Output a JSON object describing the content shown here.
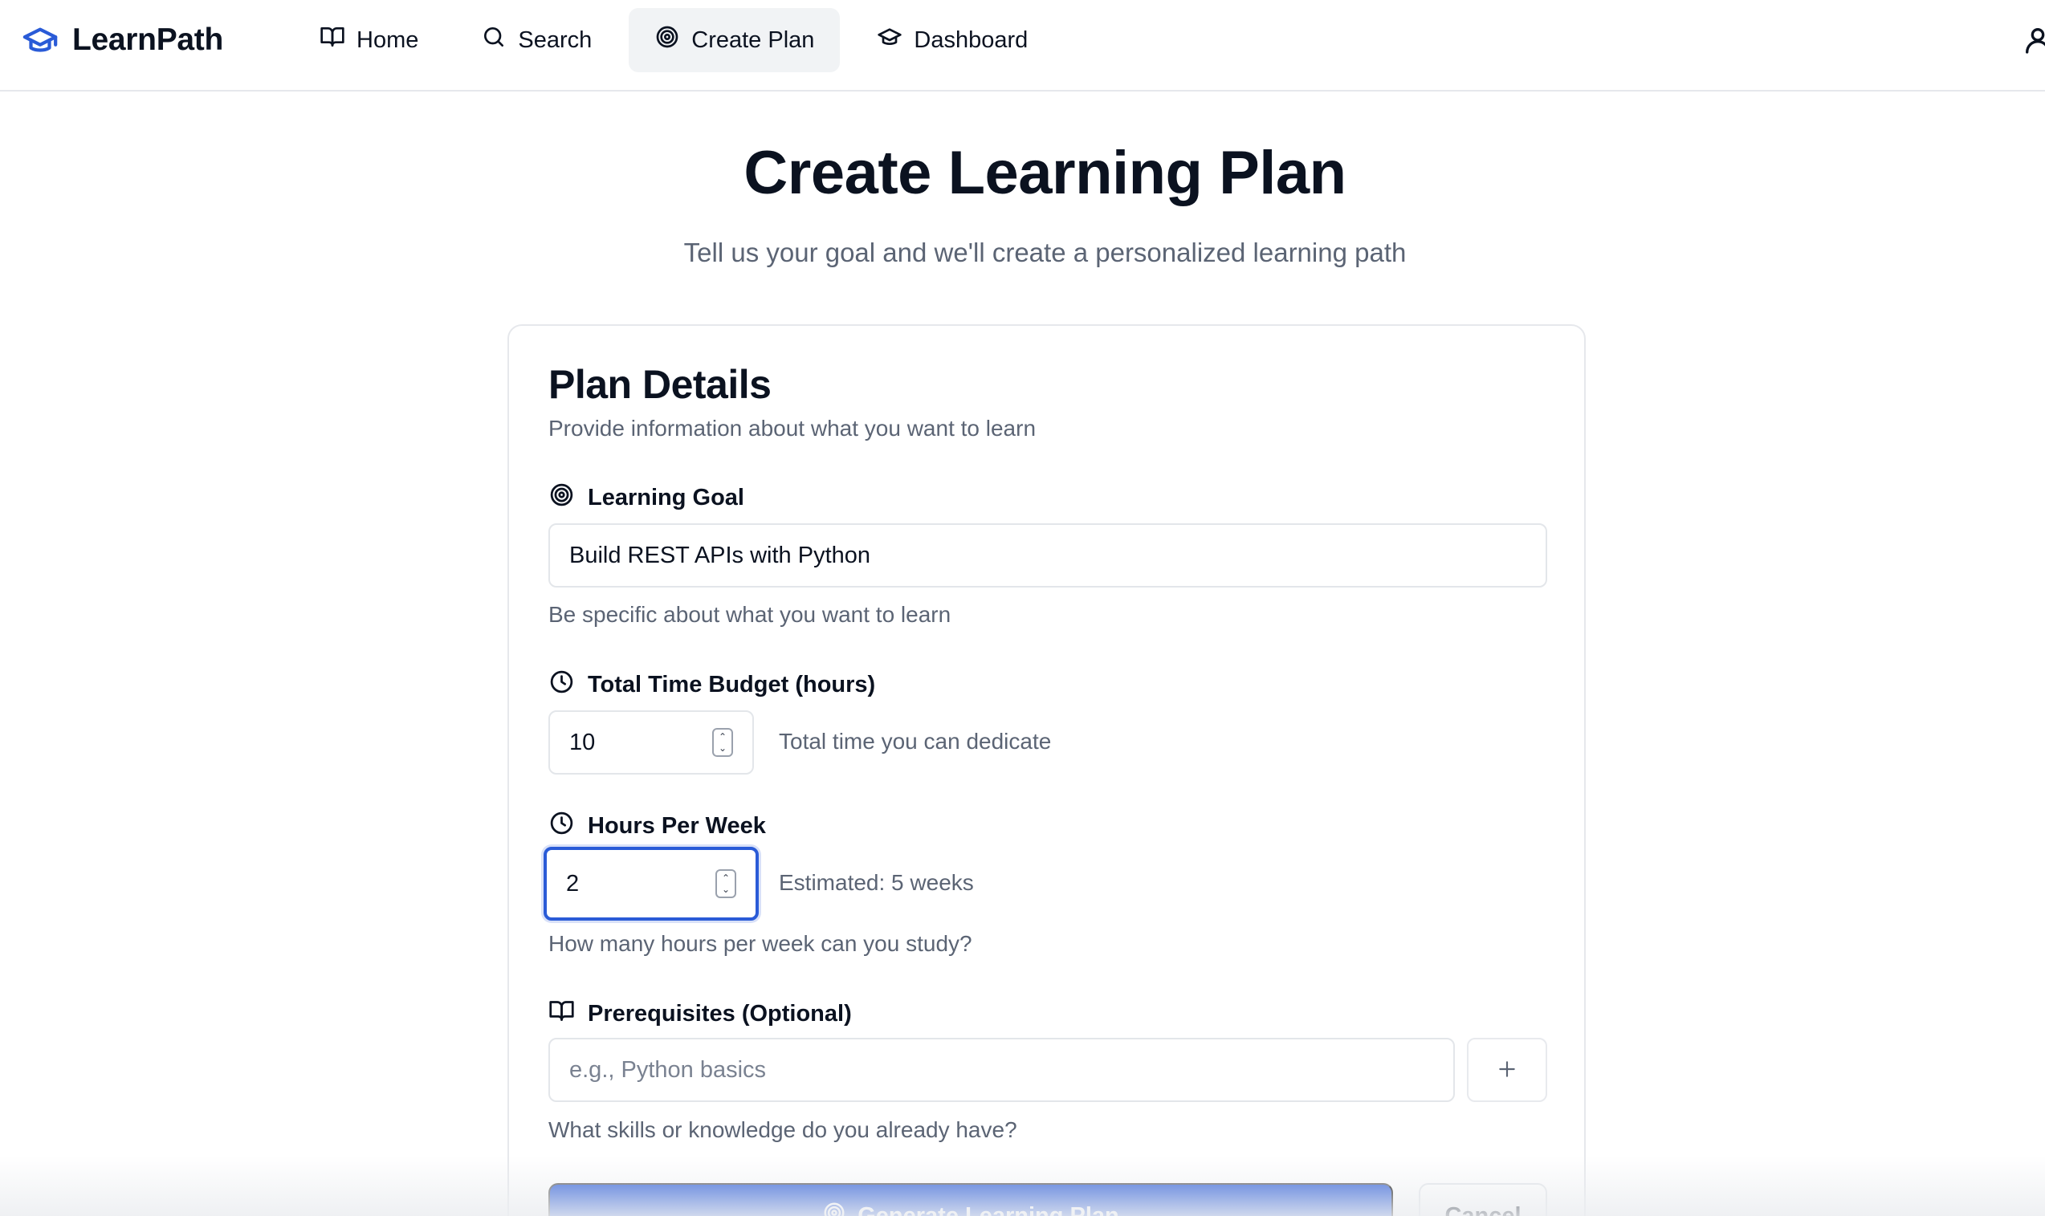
{
  "app": {
    "name": "LearnPath",
    "brand_color": "#2a5bd7"
  },
  "nav": {
    "items": [
      {
        "label": "Home",
        "icon": "book-open-icon",
        "active": false
      },
      {
        "label": "Search",
        "icon": "search-icon",
        "active": false
      },
      {
        "label": "Create Plan",
        "icon": "target-icon",
        "active": true
      },
      {
        "label": "Dashboard",
        "icon": "graduation-cap-icon",
        "active": false
      }
    ],
    "user_icon": "user-icon"
  },
  "page": {
    "title": "Create Learning Plan",
    "subtitle": "Tell us your goal and we'll create a personalized learning path"
  },
  "card": {
    "title": "Plan Details",
    "description": "Provide information about what you want to learn"
  },
  "form": {
    "goal": {
      "label": "Learning Goal",
      "icon": "target-icon",
      "value": "Build REST APIs with Python",
      "hint": "Be specific about what you want to learn"
    },
    "time_budget": {
      "label": "Total Time Budget (hours)",
      "icon": "clock-icon",
      "value": "10",
      "inline_hint": "Total time you can dedicate"
    },
    "hours_per_week": {
      "label": "Hours Per Week",
      "icon": "clock-icon",
      "value": "2",
      "inline_hint": "Estimated: 5 weeks",
      "hint": "How many hours per week can you study?"
    },
    "prerequisites": {
      "label": "Prerequisites (Optional)",
      "icon": "book-open-icon",
      "placeholder": "e.g., Python basics",
      "add_icon": "plus-icon",
      "hint": "What skills or knowledge do you already have?"
    }
  },
  "actions": {
    "generate_label": "Generate Learning Plan",
    "cancel_label": "Cancel"
  }
}
